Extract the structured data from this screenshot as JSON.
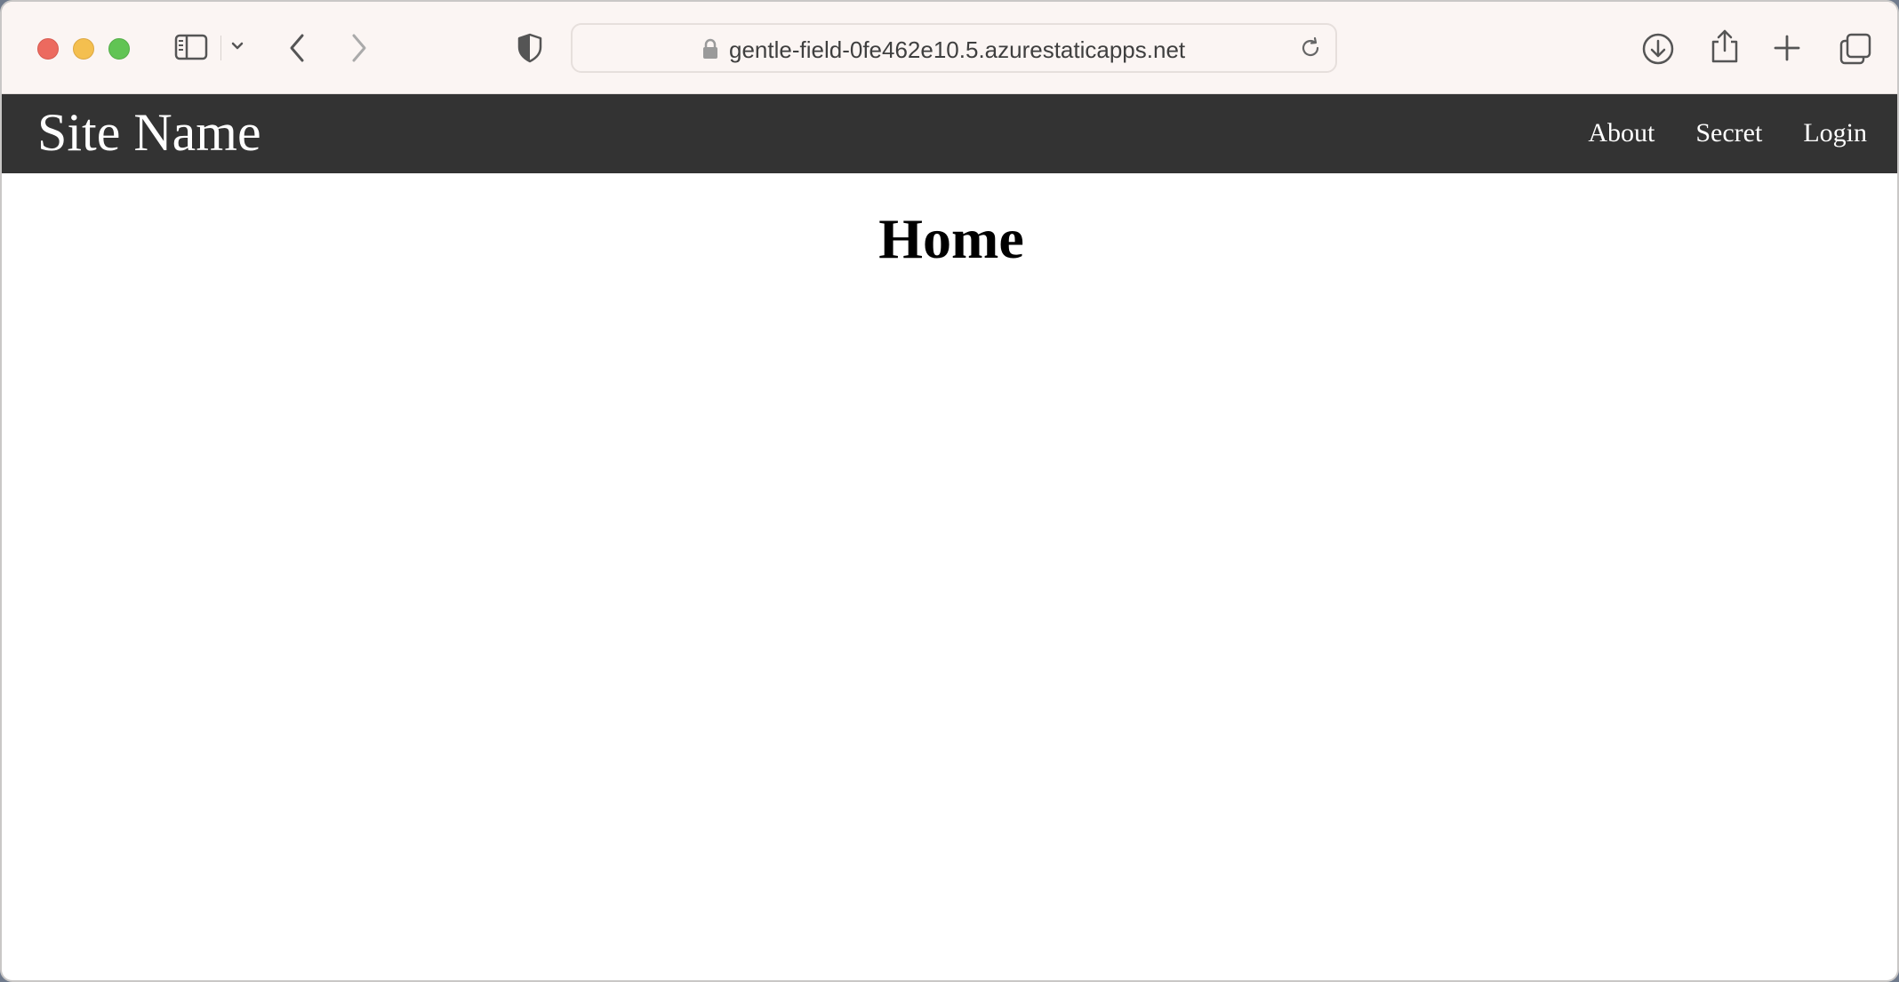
{
  "browser": {
    "url": "gentle-field-0fe462e10.5.azurestaticapps.net",
    "icons": [
      "close-icon",
      "minimize-icon",
      "zoom-icon",
      "sidebar-icon",
      "chevron-down-icon",
      "back-icon",
      "forward-icon",
      "shield-icon",
      "lock-icon",
      "reload-icon",
      "download-icon",
      "share-icon",
      "plus-icon",
      "tabs-overview-icon"
    ],
    "colors": {
      "toolbar_bg": "#fbf5f3",
      "close": "#ec6a5f",
      "minimize": "#f4bf4f",
      "zoom": "#61c454"
    }
  },
  "site": {
    "name": "Site Name",
    "nav": [
      {
        "label": "About"
      },
      {
        "label": "Secret"
      },
      {
        "label": "Login"
      }
    ],
    "header_bg": "#333333"
  },
  "page": {
    "title": "Home"
  }
}
